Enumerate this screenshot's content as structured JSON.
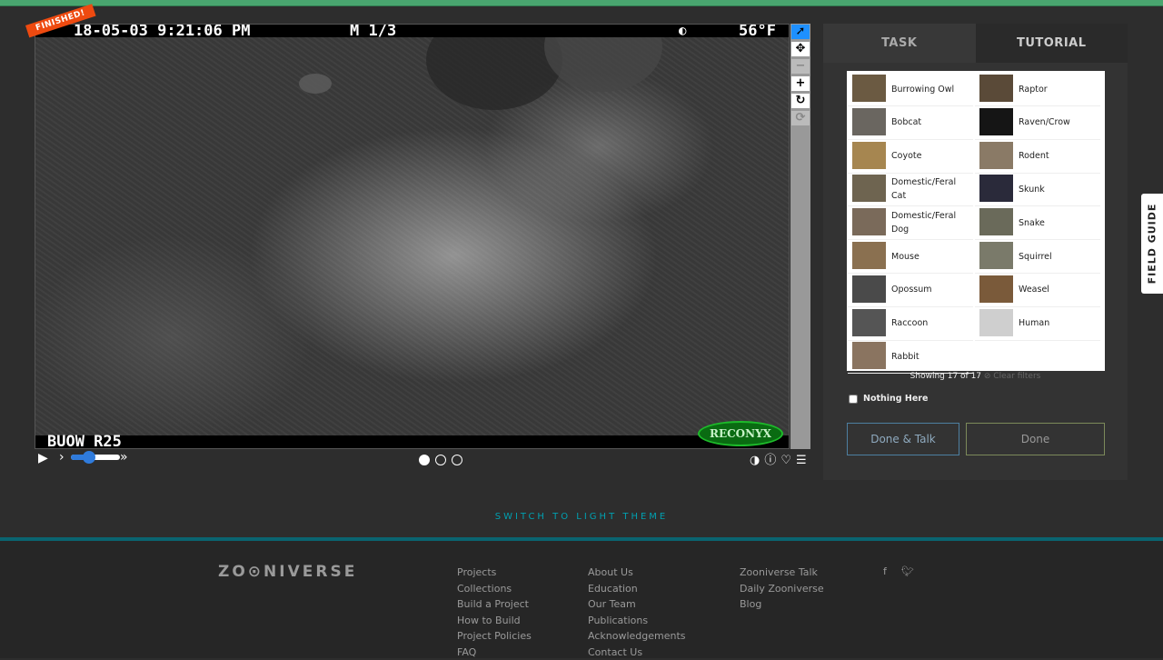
{
  "viewer": {
    "ribbon": "FINISHED!",
    "timestamp": "18-05-03 9:21:06 PM",
    "frame_code": "M 1/3",
    "temperature": "56°F",
    "camera_id": "BUOW R25",
    "brand": "RECONYX"
  },
  "controls": {
    "frame_dots": [
      true,
      false,
      false
    ]
  },
  "task_panel": {
    "tabs": [
      "TASK",
      "TUTORIAL"
    ],
    "choices": [
      {
        "label": "Burrowing Owl",
        "color": "#6b5a42"
      },
      {
        "label": "Raptor",
        "color": "#5a4a38"
      },
      {
        "label": "Bobcat",
        "color": "#6a6660"
      },
      {
        "label": "Raven/Crow",
        "color": "#151515"
      },
      {
        "label": "Coyote",
        "color": "#a68650"
      },
      {
        "label": "Rodent",
        "color": "#8a7a66"
      },
      {
        "label": "Domestic/Feral Cat",
        "color": "#6e6450"
      },
      {
        "label": "Skunk",
        "color": "#2a2a3a"
      },
      {
        "label": "Domestic/Feral Dog",
        "color": "#7a6a5a"
      },
      {
        "label": "Snake",
        "color": "#6a6a5a"
      },
      {
        "label": "Mouse",
        "color": "#8a7050"
      },
      {
        "label": "Squirrel",
        "color": "#7a7a6a"
      },
      {
        "label": "Opossum",
        "color": "#4a4a4a"
      },
      {
        "label": "Weasel",
        "color": "#7a5a3a"
      },
      {
        "label": "Raccoon",
        "color": "#555"
      },
      {
        "label": "Human",
        "color": "#cfcfcf"
      },
      {
        "label": "Rabbit",
        "color": "#8a7460"
      }
    ],
    "showing": "Showing 17 of 17",
    "clear_filters": "⊘ Clear filters",
    "nothing_here": "Nothing Here",
    "done_talk": "Done & Talk",
    "done": "Done"
  },
  "field_guide": "FIELD GUIDE",
  "switch_theme": "SWITCH TO LIGHT THEME",
  "footer": {
    "logo": "ZOOniverse",
    "col1": [
      "Projects",
      "Collections",
      "Build a Project",
      "How to Build",
      "Project Policies",
      "FAQ"
    ],
    "col2": [
      "About Us",
      "Education",
      "Our Team",
      "Publications",
      "Acknowledgements",
      "Contact Us"
    ],
    "col3": [
      "Zooniverse Talk",
      "Daily Zooniverse",
      "Blog"
    ],
    "social_icons": [
      "facebook-icon",
      "twitter-icon"
    ]
  }
}
